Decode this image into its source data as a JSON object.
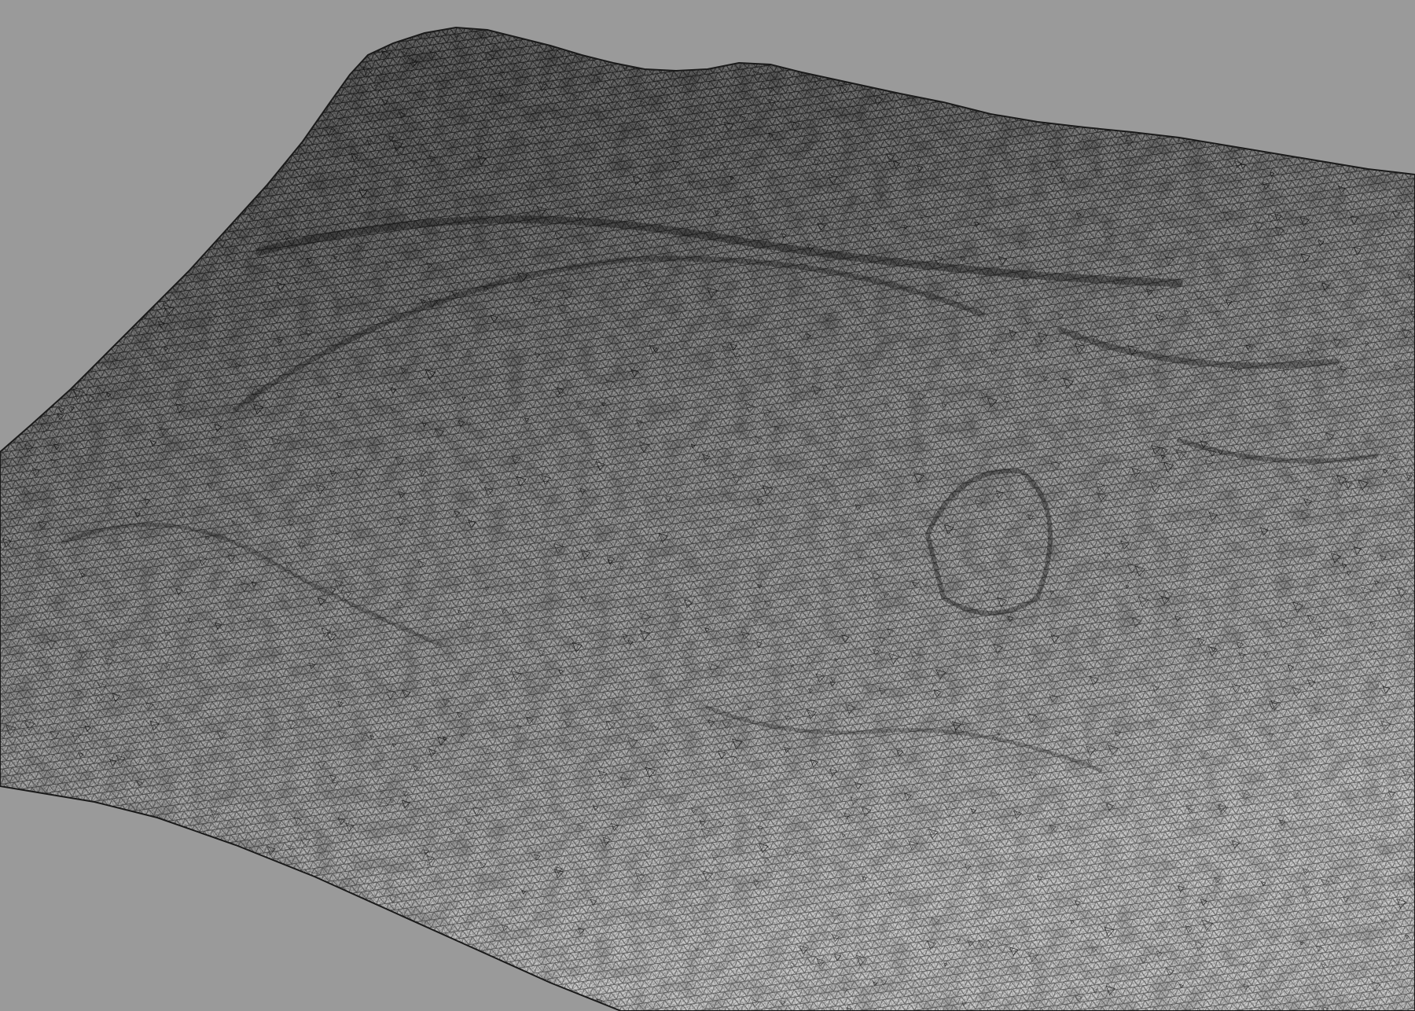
{
  "scene": {
    "subject": "terrain-wireframe-mesh",
    "colors": {
      "background": "#9a9a9a",
      "mesh_surface_light": "#f2f2f2",
      "mesh_surface_dark": "#3c3c3c",
      "wire": "#0b0b0b"
    }
  }
}
